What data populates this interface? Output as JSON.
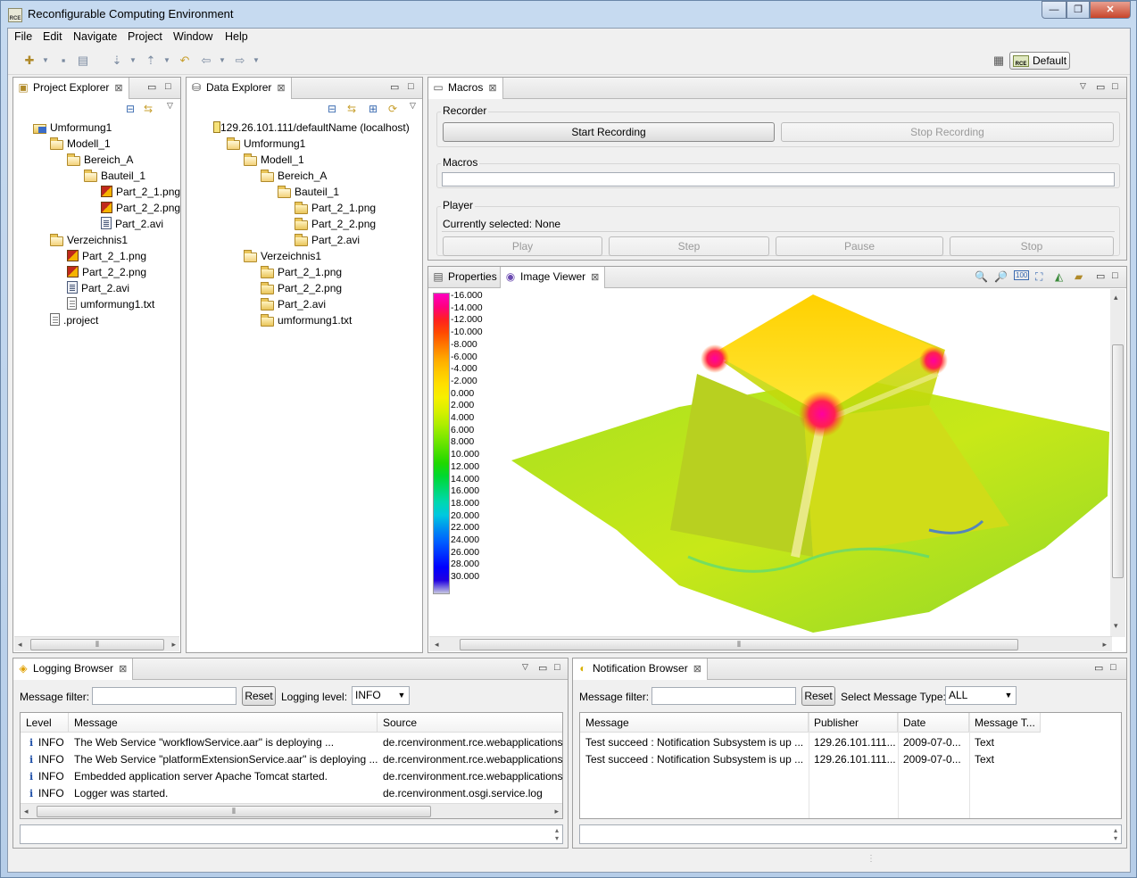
{
  "window": {
    "title": "Reconfigurable Computing Environment",
    "icon_text": "RCE",
    "controls": [
      "—",
      "❐",
      "✕"
    ]
  },
  "menu": [
    "File",
    "Edit",
    "Navigate",
    "Project",
    "Window",
    "Help"
  ],
  "perspective": {
    "icon_text": "RCE",
    "label": "Default"
  },
  "project_explorer": {
    "tab": "Project Explorer",
    "tree": [
      {
        "label": "Umformung1",
        "icon": "project",
        "depth": 0
      },
      {
        "label": "Modell_1",
        "icon": "folder-open",
        "depth": 1
      },
      {
        "label": "Bereich_A",
        "icon": "folder-open",
        "depth": 2
      },
      {
        "label": "Bauteil_1",
        "icon": "folder-open",
        "depth": 3
      },
      {
        "label": "Part_2_1.png",
        "icon": "png",
        "depth": 4
      },
      {
        "label": "Part_2_2.png",
        "icon": "png",
        "depth": 4
      },
      {
        "label": "Part_2.avi",
        "icon": "avi",
        "depth": 4
      },
      {
        "label": "Verzeichnis1",
        "icon": "folder-open",
        "depth": 1
      },
      {
        "label": "Part_2_1.png",
        "icon": "png",
        "depth": 2
      },
      {
        "label": "Part_2_2.png",
        "icon": "png",
        "depth": 2
      },
      {
        "label": "Part_2.avi",
        "icon": "avi",
        "depth": 2
      },
      {
        "label": "umformung1.txt",
        "icon": "txt",
        "depth": 2
      },
      {
        "label": ".project",
        "icon": "txt",
        "depth": 1
      }
    ]
  },
  "data_explorer": {
    "tab": "Data Explorer",
    "tree": [
      {
        "label": "129.26.101.111/defaultName (localhost)",
        "icon": "host",
        "depth": 0
      },
      {
        "label": "Umformung1",
        "icon": "folder-open",
        "depth": 1
      },
      {
        "label": "Modell_1",
        "icon": "folder-open",
        "depth": 2
      },
      {
        "label": "Bereich_A",
        "icon": "folder-open",
        "depth": 3
      },
      {
        "label": "Bauteil_1",
        "icon": "folder-open",
        "depth": 4
      },
      {
        "label": "Part_2_1.png",
        "icon": "folder",
        "depth": 5
      },
      {
        "label": "Part_2_2.png",
        "icon": "folder",
        "depth": 5
      },
      {
        "label": "Part_2.avi",
        "icon": "folder",
        "depth": 5
      },
      {
        "label": "Verzeichnis1",
        "icon": "folder-open",
        "depth": 2
      },
      {
        "label": "Part_2_1.png",
        "icon": "folder",
        "depth": 3
      },
      {
        "label": "Part_2_2.png",
        "icon": "folder",
        "depth": 3
      },
      {
        "label": "Part_2.avi",
        "icon": "folder",
        "depth": 3
      },
      {
        "label": "umformung1.txt",
        "icon": "folder",
        "depth": 3
      }
    ]
  },
  "macros": {
    "tab": "Macros",
    "recorder_label": "Recorder",
    "start_recording": "Start Recording",
    "stop_recording": "Stop Recording",
    "macros_label": "Macros",
    "player_label": "Player",
    "currently_selected": "Currently selected: None",
    "play": "Play",
    "step": "Step",
    "pause": "Pause",
    "stop": "Stop"
  },
  "image_viewer": {
    "tabs": [
      "Properties",
      "Image Viewer"
    ],
    "legend": [
      "-16.000",
      "-14.000",
      "-12.000",
      "-10.000",
      "-8.000",
      "-6.000",
      "-4.000",
      "-2.000",
      "0.000",
      "2.000",
      "4.000",
      "6.000",
      "8.000",
      "10.000",
      "12.000",
      "14.000",
      "16.000",
      "18.000",
      "20.000",
      "22.000",
      "24.000",
      "26.000",
      "28.000",
      "30.000"
    ],
    "legend_colors": [
      "#ff00c0",
      "#ff0080",
      "#ff2020",
      "#ff4a00",
      "#ff7a00",
      "#ffa800",
      "#ffc800",
      "#ffe000",
      "#f6f000",
      "#d8f000",
      "#b0ee00",
      "#80e800",
      "#50e000",
      "#20d800",
      "#00d830",
      "#00d870",
      "#00d8b0",
      "#00c8e0",
      "#0090f0",
      "#0060ff",
      "#0030ff",
      "#0000ff",
      "#2000e0",
      "#c8c8e0"
    ]
  },
  "logging": {
    "tab": "Logging Browser",
    "filter_label": "Message filter:",
    "filter_value": "",
    "reset": "Reset",
    "level_label": "Logging level:",
    "level_value": "INFO",
    "columns": [
      "Level",
      "Message",
      "Source"
    ],
    "rows": [
      {
        "level": "INFO",
        "message": "The Web Service \"workflowService.aar\" is deploying ...",
        "source": "de.rcenvironment.rce.webapplications"
      },
      {
        "level": "INFO",
        "message": "The Web Service \"platformExtensionService.aar\" is deploying ...",
        "source": "de.rcenvironment.rce.webapplications"
      },
      {
        "level": "INFO",
        "message": "Embedded application server Apache Tomcat started.",
        "source": "de.rcenvironment.rce.webapplications"
      },
      {
        "level": "INFO",
        "message": "Logger was started.",
        "source": "de.rcenvironment.osgi.service.log"
      }
    ]
  },
  "notification": {
    "tab": "Notification Browser",
    "filter_label": "Message filter:",
    "filter_value": "",
    "reset": "Reset",
    "type_label": "Select Message Type:",
    "type_value": "ALL",
    "columns": [
      "Message",
      "Publisher",
      "Date",
      "Message T..."
    ],
    "rows": [
      {
        "message": "Test succeed : Notification Subsystem is up ...",
        "publisher": "129.26.101.111...",
        "date": "2009-07-0...",
        "type": "Text"
      },
      {
        "message": "Test succeed : Notification Subsystem is up ...",
        "publisher": "129.26.101.111...",
        "date": "2009-07-0...",
        "type": "Text"
      }
    ]
  }
}
